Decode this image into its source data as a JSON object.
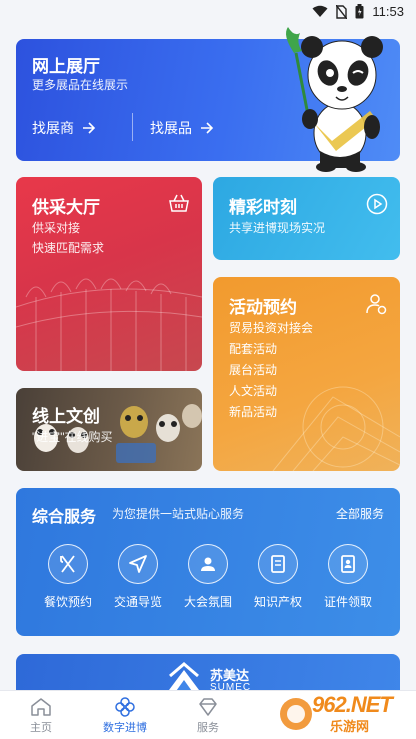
{
  "status_bar": {
    "time": "11:53"
  },
  "hall": {
    "title": "网上展厅",
    "subtitle": "更多展品在线展示",
    "find_exhibitor": "找展商",
    "find_exhibit": "找展品"
  },
  "supply": {
    "title": "供采大厅",
    "line1": "供采对接",
    "line2": "快速匹配需求",
    "icon": "shopping-basket-icon"
  },
  "moments": {
    "title": "精彩时刻",
    "subtitle": "共享进博现场实况",
    "icon": "play-icon"
  },
  "activity": {
    "title": "活动预约",
    "items": [
      "贸易投资对接会",
      "配套活动",
      "展台活动",
      "人文活动",
      "新品活动"
    ],
    "icon": "user-settings-icon"
  },
  "creative": {
    "title": "线上文创",
    "subtitle": "\"进宝\"在线购买"
  },
  "services": {
    "title": "综合服务",
    "description": "为您提供一站式贴心服务",
    "all_label": "全部服务",
    "items": [
      {
        "label": "餐饮预约",
        "icon": "utensils-icon"
      },
      {
        "label": "交通导览",
        "icon": "navigation-arrow-icon"
      },
      {
        "label": "大会氛围",
        "icon": "person-badge-icon"
      },
      {
        "label": "知识产权",
        "icon": "book-icon"
      },
      {
        "label": "证件领取",
        "icon": "id-card-icon"
      }
    ]
  },
  "sponsor": {
    "name": "苏美达",
    "english": "SUMEC"
  },
  "bottom_nav": {
    "items": [
      {
        "label": "主页",
        "icon": "home-icon",
        "active": false
      },
      {
        "label": "数字进博",
        "icon": "clover-icon",
        "active": true
      },
      {
        "label": "服务",
        "icon": "diamond-icon",
        "active": false
      }
    ]
  },
  "watermark": {
    "text": "962.NET",
    "sub": "乐游网"
  },
  "colors": {
    "hall_blue": "#2d52de",
    "supply_red": "#d8354a",
    "moments_cyan": "#2da8e2",
    "activity_orange": "#f29a2e",
    "services_blue": "#2f78de",
    "nav_active": "#2f6fe0"
  }
}
